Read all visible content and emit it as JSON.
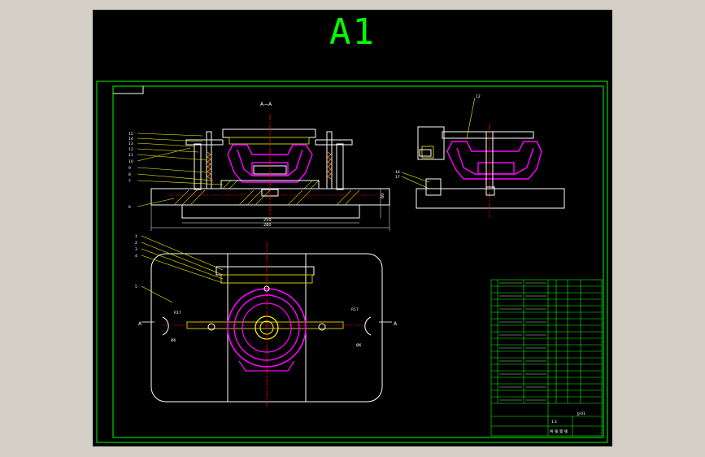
{
  "sheet": {
    "label": "A1",
    "background": "#000000",
    "frame_color": "#00ff00"
  },
  "views": {
    "section_label": "A—A",
    "section_marks": [
      "A",
      "A"
    ],
    "overall_width": "280",
    "base_width": "250",
    "height_dim": "60",
    "right_angle": "R17",
    "left_angle": "R17",
    "left_diam": "Ø6",
    "right_diam": "Ø6"
  },
  "balloons": {
    "front_left": [
      "15",
      "14",
      "13",
      "12",
      "11",
      "10",
      "9",
      "8",
      "7",
      "6"
    ],
    "side_top": "12",
    "side_left": [
      "16",
      "17"
    ],
    "top_left": [
      "1",
      "2",
      "3",
      "4",
      "5"
    ]
  },
  "colors": {
    "outline": "#ffffff",
    "body": "#ff00ff",
    "center": "#ff0000",
    "hatch": "#c8c800",
    "spring": "#ff8000",
    "frame": "#00ff00",
    "yellow": "#ffff00"
  },
  "title_block": {
    "drawing_number": "JJ-01",
    "scale": "1:1",
    "sheet_text": "共 张 第 张"
  }
}
